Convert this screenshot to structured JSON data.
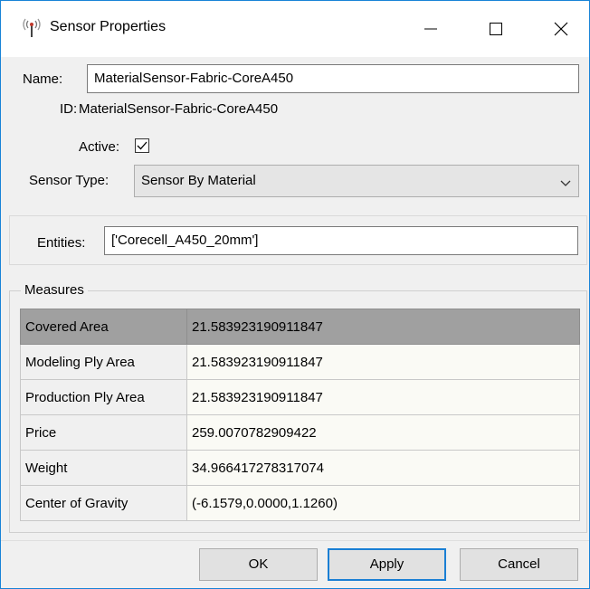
{
  "window": {
    "title": "Sensor Properties",
    "icon": "sensor-antenna-icon"
  },
  "titlebar_buttons": {
    "minimize_icon": "minimize-icon",
    "maximize_icon": "maximize-icon",
    "close_icon": "close-icon"
  },
  "form": {
    "name_label": "Name:",
    "name_value": "MaterialSensor-Fabric-CoreA450",
    "id_label": "ID:",
    "id_value": "MaterialSensor-Fabric-CoreA450",
    "active_label": "Active:",
    "active_checked": true,
    "sensor_type_label": "Sensor Type:",
    "sensor_type_value": "Sensor By Material",
    "entities_label": "Entities:",
    "entities_value": "['Corecell_A450_20mm']"
  },
  "measures": {
    "title": "Measures",
    "rows": [
      {
        "key": "Covered Area",
        "value": "21.583923190911847"
      },
      {
        "key": "Modeling Ply Area",
        "value": "21.583923190911847"
      },
      {
        "key": "Production Ply Area",
        "value": "21.583923190911847"
      },
      {
        "key": "Price",
        "value": "259.0070782909422"
      },
      {
        "key": "Weight",
        "value": "34.966417278317074"
      },
      {
        "key": "Center of Gravity",
        "value": "(-6.1579,0.0000,1.1260)"
      }
    ],
    "selected_row": "Covered Area"
  },
  "buttons": {
    "ok": "OK",
    "apply": "Apply",
    "cancel": "Cancel"
  },
  "colors": {
    "accent": "#1a7fd4",
    "selected_row": "#a0a0a0"
  }
}
